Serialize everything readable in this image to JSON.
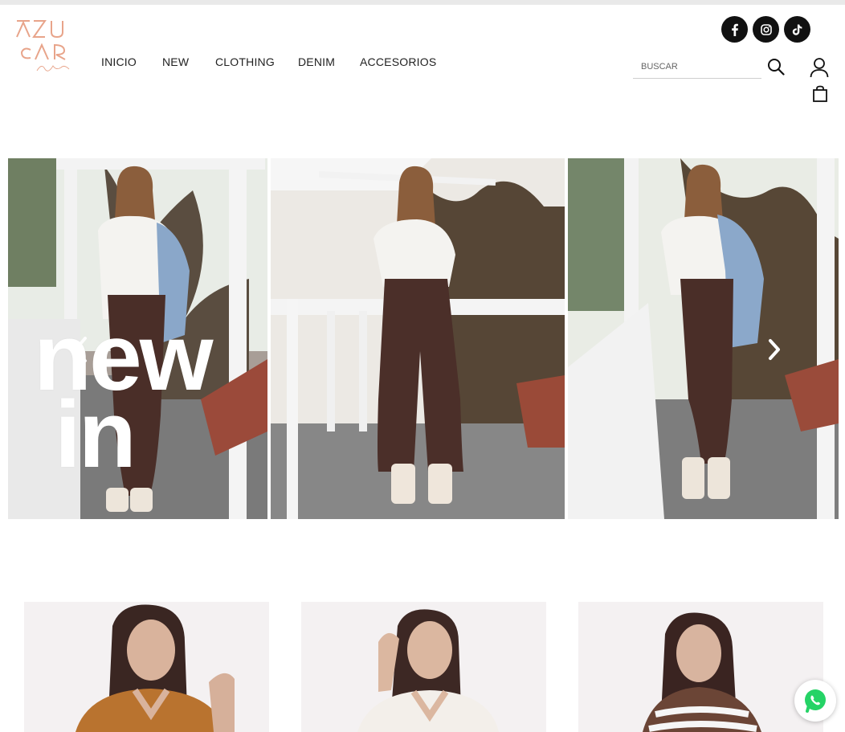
{
  "brand": {
    "logo_text_1": "AZU",
    "logo_text_2": "CAR",
    "logo_script": "by Vilma",
    "logo_color": "#e8a48a"
  },
  "nav": {
    "items": [
      {
        "label": "INICIO"
      },
      {
        "label": "NEW"
      },
      {
        "label": "CLOTHING"
      },
      {
        "label": "DENIM"
      },
      {
        "label": "ACCESORIOS"
      }
    ]
  },
  "social": {
    "icons": [
      "facebook-icon",
      "instagram-icon",
      "tiktok-icon"
    ]
  },
  "search": {
    "placeholder": "BUSCAR"
  },
  "header_icons": [
    "search-icon",
    "user-icon",
    "shopping-bag-icon"
  ],
  "hero": {
    "line1": "new",
    "line2": "in",
    "prev_icon": "chevron-left-icon",
    "next_icon": "chevron-right-icon"
  },
  "products": [
    {
      "image": "woman-in-camel-sweater"
    },
    {
      "image": "woman-in-white-top"
    },
    {
      "image": "woman-in-brown-striped-sweater"
    }
  ],
  "colors": {
    "accent": "#e8a48a",
    "dark": "#111111",
    "whatsapp": "#25d366"
  }
}
